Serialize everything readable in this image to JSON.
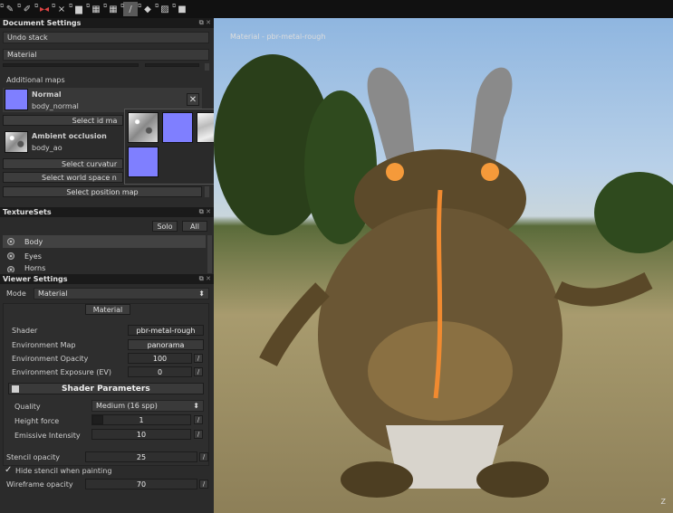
{
  "toolbar": {
    "items": [
      {
        "icon": "paint-icon",
        "glyph": "✎"
      },
      {
        "icon": "brush-icon",
        "glyph": "✐"
      },
      {
        "icon": "symmetry-icon",
        "glyph": "▸◂"
      },
      {
        "icon": "mirror-icon",
        "glyph": "×x"
      },
      {
        "icon": "camera-icon",
        "glyph": "▆"
      },
      {
        "icon": "grid-icon",
        "glyph": "▦"
      },
      {
        "icon": "grid-view-icon",
        "glyph": "▦"
      },
      {
        "icon": "paint-brush-icon",
        "glyph": "/"
      },
      {
        "icon": "eraser-icon",
        "glyph": "◆"
      },
      {
        "icon": "image-icon",
        "glyph": "▨"
      },
      {
        "icon": "stamp-icon",
        "glyph": "■"
      }
    ]
  },
  "document_settings": {
    "header": "Document Settings",
    "undo_stack": "Undo stack",
    "material": "Material",
    "additional_maps_label": "Additional maps",
    "normal": {
      "title": "Normal",
      "file": "body_normal",
      "select_label": "Select id ma"
    },
    "ao": {
      "title": "Ambient occlusion",
      "file": "body_ao"
    },
    "select_curvature": "Select curvatur",
    "select_world_space": "Select world space n",
    "select_position": "Select position map"
  },
  "texture_sets": {
    "header": "TextureSets",
    "solo": "Solo",
    "all": "All",
    "items": [
      "Body",
      "Eyes",
      "Horns"
    ]
  },
  "viewer_settings": {
    "header": "Viewer Settings",
    "mode_label": "Mode",
    "mode_value": "Material",
    "material_btn": "Material",
    "shader_label": "Shader",
    "shader_value": "pbr-metal-rough",
    "env_map_label": "Environment Map",
    "env_map_value": "panorama",
    "env_opacity_label": "Environment Opacity",
    "env_opacity_value": "100",
    "env_exposure_label": "Environment Exposure (EV)",
    "env_exposure_value": "0",
    "shader_params_label": "Shader Parameters",
    "quality_label": "Quality",
    "quality_value": "Medium (16 spp)",
    "height_force_label": "Height force",
    "height_force_value": "1",
    "emissive_label": "Emissive Intensity",
    "emissive_value": "10",
    "stencil_opacity_label": "Stencil opacity",
    "stencil_opacity_value": "25",
    "hide_stencil_label": "Hide stencil when painting",
    "wireframe_label": "Wireframe opacity",
    "wireframe_value": "70"
  },
  "viewport": {
    "title": "Material - pbr-metal-rough",
    "gizmo": "Z"
  }
}
